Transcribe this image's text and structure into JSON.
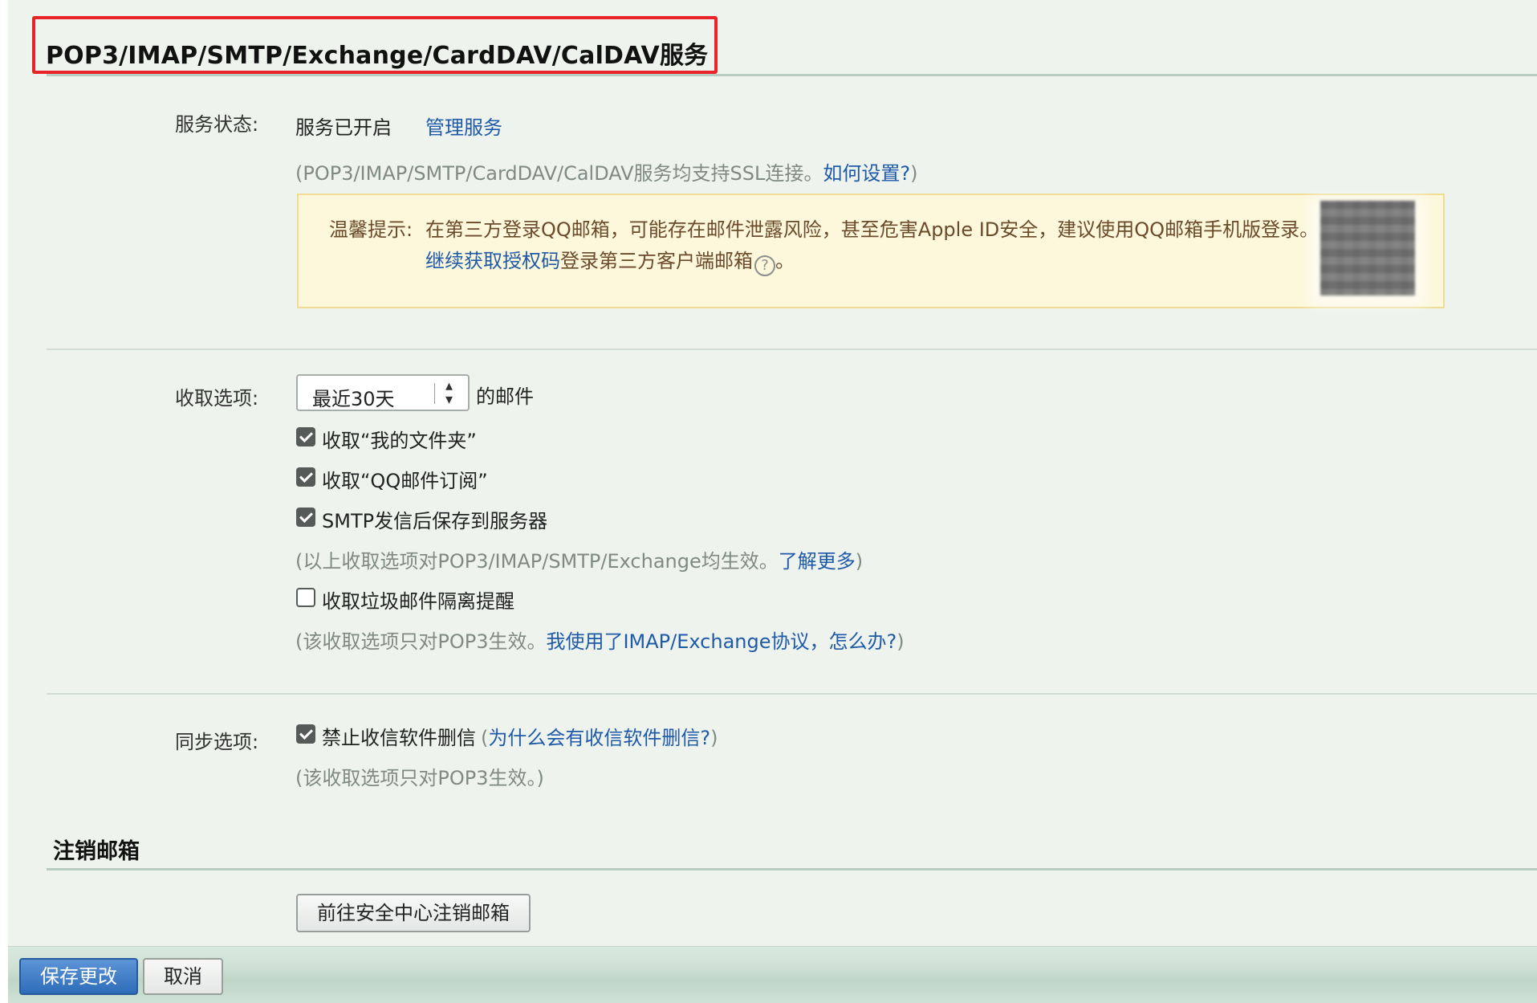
{
  "header": {
    "title": "POP3/IMAP/SMTP/Exchange/CardDAV/CalDAV服务"
  },
  "service": {
    "label": "服务状态:",
    "status": "服务已开启",
    "manage_link": "管理服务",
    "ssl_note_prefix": "(POP3/IMAP/SMTP/CardDAV/CalDAV服务均支持SSL连接。",
    "ssl_note_link": "如何设置?",
    "ssl_note_suffix": ")"
  },
  "tip": {
    "label": "温馨提示:",
    "line1": "在第三方登录QQ邮箱，可能存在邮件泄露风险，甚至危害Apple ID安全，建议使用QQ邮箱手机版登录。",
    "line2_link": "继续获取授权码",
    "line2_text": "登录第三方客户端邮箱",
    "line2_end": "。",
    "help_icon": "?"
  },
  "fetch": {
    "label": "收取选项:",
    "range_selected": "最近30天",
    "range_suffix": "的邮件",
    "options": [
      {
        "label": "收取“我的文件夹”",
        "checked": true
      },
      {
        "label": "收取“QQ邮件订阅”",
        "checked": true
      },
      {
        "label": "SMTP发信后保存到服务器",
        "checked": true
      },
      {
        "label": "收取垃圾邮件隔离提醒",
        "checked": false
      }
    ],
    "note1_prefix": "(以上收取选项对POP3/IMAP/SMTP/Exchange均生效。",
    "note1_link": "了解更多",
    "note1_suffix": ")",
    "note2_prefix": "(该收取选项只对POP3生效。",
    "note2_link": "我使用了IMAP/Exchange协议，怎么办?",
    "note2_suffix": ")"
  },
  "sync": {
    "label": "同步选项:",
    "option_label": "禁止收信软件删信",
    "option_checked": true,
    "why_prefix": "(",
    "why_link": "为什么会有收信软件删信?",
    "why_suffix": ")",
    "note": "(该收取选项只对POP3生效。)"
  },
  "cancel_account": {
    "title": "注销邮箱",
    "button": "前往安全中心注销邮箱"
  },
  "footer": {
    "save_button": "保存更改",
    "cancel_button": "取消"
  },
  "colors": {
    "link": "#1f5aa8",
    "highlight_box": "#e8242a",
    "tip_background": "#fdf7dc",
    "primary_button": "#2f6dba"
  }
}
